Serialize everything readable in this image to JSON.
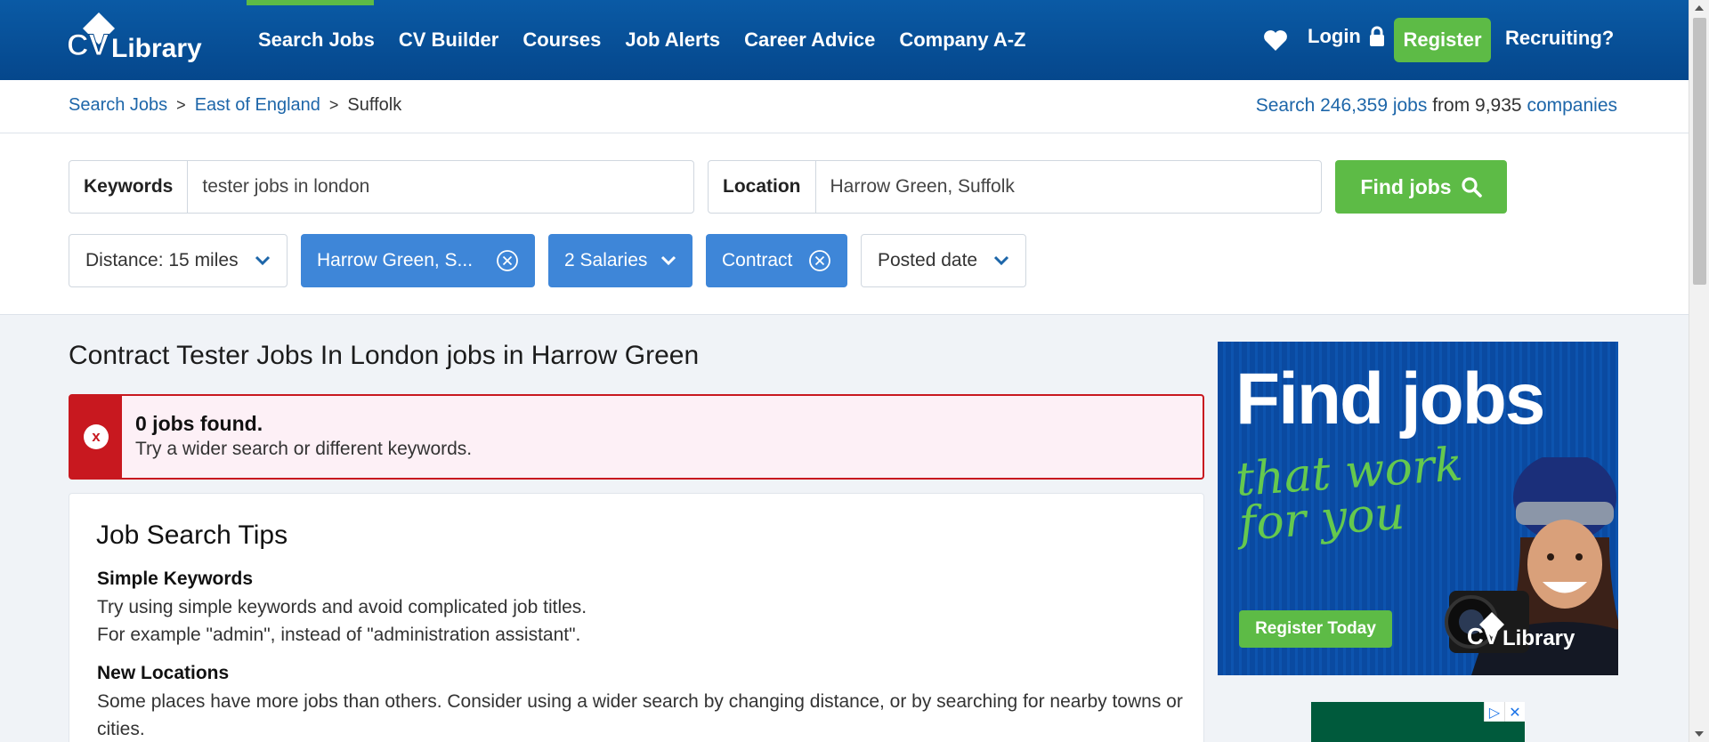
{
  "nav": {
    "logo_text": "CV-Library",
    "links": [
      "Search Jobs",
      "CV Builder",
      "Courses",
      "Job Alerts",
      "Career Advice",
      "Company A-Z"
    ],
    "login": "Login",
    "register": "Register",
    "recruiting": "Recruiting?"
  },
  "breadcrumb": {
    "items": [
      "Search Jobs",
      "East of England",
      "Suffolk"
    ],
    "separator": ">"
  },
  "stats": {
    "prefix": "Search ",
    "jobs": "246,359 jobs",
    "middle": " from 9,935 ",
    "companies": "companies"
  },
  "search": {
    "keywords_label": "Keywords",
    "keywords_value": "tester jobs in london",
    "location_label": "Location",
    "location_value": "Harrow Green, Suffolk",
    "find_button": "Find jobs"
  },
  "filters": {
    "distance": "Distance: 15 miles",
    "location_chip": "Harrow Green, S...",
    "salaries": "2 Salaries",
    "contract": "Contract",
    "posted": "Posted date"
  },
  "results": {
    "title": "Contract Tester Jobs In London jobs in Harrow Green",
    "alert_mark": "x",
    "alert_title": "0 jobs found.",
    "alert_text": "Try a wider search or different keywords."
  },
  "tips": {
    "heading": "Job Search Tips",
    "simple_title": "Simple Keywords",
    "simple_line1": "Try using simple keywords and avoid complicated job titles.",
    "simple_line2": "For example \"admin\", instead of \"administration assistant\".",
    "locations_title": "New Locations",
    "locations_text": "Some places have more jobs than others. Consider using a wider search by changing distance, or by searching for nearby towns or cities."
  },
  "ad": {
    "headline": "Find jobs",
    "tagline_1": "that work",
    "tagline_2": "for you",
    "cta": "Register Today",
    "brand": "CV-Library"
  },
  "ad2": {
    "glyph_1": "▷",
    "glyph_2": "✕"
  },
  "colors": {
    "nav_blue": "#05478c",
    "accent_green": "#5dbb46",
    "chip_blue": "#3e86d8",
    "link_blue": "#1d66a9",
    "alert_red": "#c8181f"
  }
}
